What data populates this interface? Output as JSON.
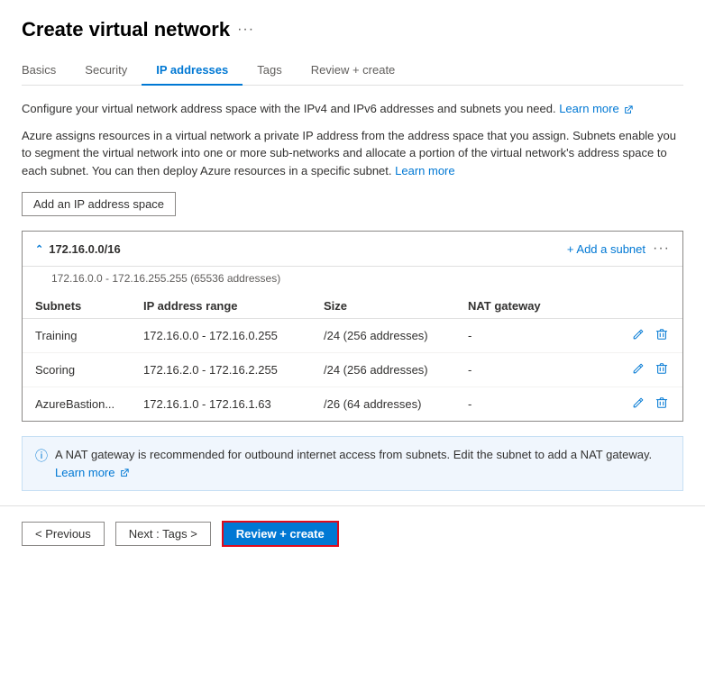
{
  "page": {
    "title": "Create virtual network",
    "ellipsis": "···"
  },
  "tabs": [
    {
      "id": "basics",
      "label": "Basics",
      "active": false
    },
    {
      "id": "security",
      "label": "Security",
      "active": false
    },
    {
      "id": "ip-addresses",
      "label": "IP addresses",
      "active": true
    },
    {
      "id": "tags",
      "label": "Tags",
      "active": false
    },
    {
      "id": "review-create",
      "label": "Review + create",
      "active": false
    }
  ],
  "description1": "Configure your virtual network address space with the IPv4 and IPv6 addresses and subnets you need.",
  "description1_link": "Learn more",
  "description2": "Azure assigns resources in a virtual network a private IP address from the address space that you assign. Subnets enable you to segment the virtual network into one or more sub-networks and allocate a portion of the virtual network's address space to each subnet. You can then deploy Azure resources in a specific subnet.",
  "description2_link": "Learn more",
  "add_ip_btn": "Add an IP address space",
  "ip_space": {
    "cidr": "172.16.0.0/16",
    "range_desc": "172.16.0.0 - 172.16.255.255 (65536 addresses)",
    "add_subnet_label": "+ Add a subnet",
    "more_label": "···"
  },
  "table": {
    "headers": [
      "Subnets",
      "IP address range",
      "Size",
      "NAT gateway"
    ],
    "rows": [
      {
        "name": "Training",
        "ip_range": "172.16.0.0 - 172.16.0.255",
        "size": "/24 (256 addresses)",
        "nat": "-"
      },
      {
        "name": "Scoring",
        "ip_range": "172.16.2.0 - 172.16.2.255",
        "size": "/24 (256 addresses)",
        "nat": "-"
      },
      {
        "name": "AzureBastion...",
        "ip_range": "172.16.1.0 - 172.16.1.63",
        "size": "/26 (64 addresses)",
        "nat": "-"
      }
    ]
  },
  "nat_info": "A NAT gateway is recommended for outbound internet access from subnets. Edit the subnet to add a NAT gateway.",
  "nat_learn_link": "Learn more",
  "footer": {
    "previous_label": "< Previous",
    "next_label": "Next : Tags >",
    "review_label": "Review + create"
  }
}
